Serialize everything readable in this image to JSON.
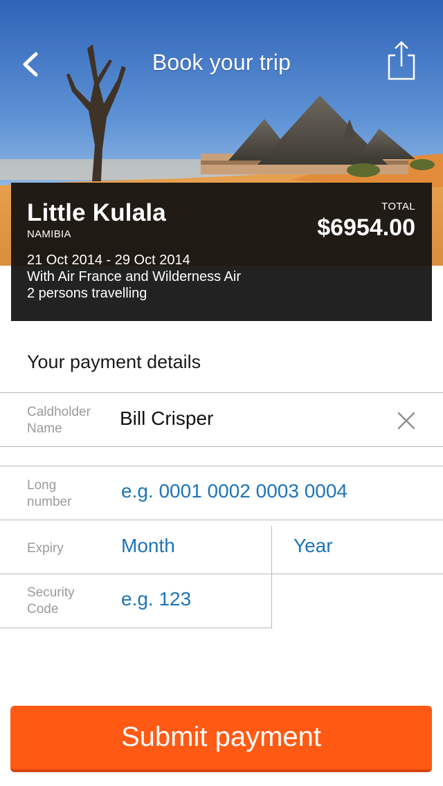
{
  "nav": {
    "title": "Book your trip",
    "back_icon": "chevron-left-icon",
    "share_icon": "share-icon"
  },
  "trip": {
    "name": "Little Kulala",
    "country": "NAMIBIA",
    "total_label": "TOTAL",
    "total_price": "$6954.00",
    "dates": "21 Oct 2014 - 29 Oct 2014",
    "airlines": "With Air France and Wilderness Air",
    "travellers": "2 persons travelling"
  },
  "payment": {
    "title": "Your payment details",
    "cardholder": {
      "label_line1": "Caldholder",
      "label_line2": "Name",
      "value": "Bill Crisper",
      "clear_icon": "close-icon"
    },
    "long_number": {
      "label_line1": "Long",
      "label_line2": "number",
      "placeholder": "e.g. 0001 0002 0003 0004"
    },
    "expiry": {
      "label": "Expiry",
      "month_placeholder": "Month",
      "year_placeholder": "Year"
    },
    "security": {
      "label_line1": "Security",
      "label_line2": "Code",
      "placeholder": "e.g. 123"
    }
  },
  "submit_label": "Submit payment",
  "colors": {
    "accent": "#ff5a14",
    "link_blue": "#1c74b8",
    "card_bg": "#111111"
  }
}
